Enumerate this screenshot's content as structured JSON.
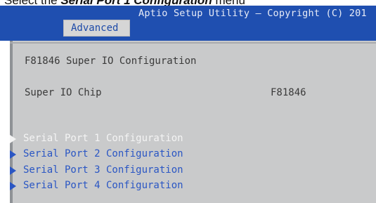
{
  "caption": {
    "lead": "Select the",
    "emphasis": "Serial Port 1 Configuration",
    "tail": "menu"
  },
  "header": {
    "title": "Aptio Setup Utility – Copyright (C) 201",
    "tab_label": "Advanced"
  },
  "page": {
    "heading": "F81846 Super IO Configuration",
    "chip_label": "Super IO Chip",
    "chip_value": "F81846"
  },
  "menu": {
    "items": [
      {
        "label": "Serial Port 1 Configuration",
        "selected": true
      },
      {
        "label": "Serial Port 2 Configuration",
        "selected": false
      },
      {
        "label": "Serial Port 3 Configuration",
        "selected": false
      },
      {
        "label": "Serial Port 4 Configuration",
        "selected": false
      }
    ]
  },
  "colors": {
    "header_bg": "#1f4fb0",
    "panel_bg": "#c9cacb",
    "item_text": "#2a56c4",
    "selected_text": "#f4f4f4"
  }
}
